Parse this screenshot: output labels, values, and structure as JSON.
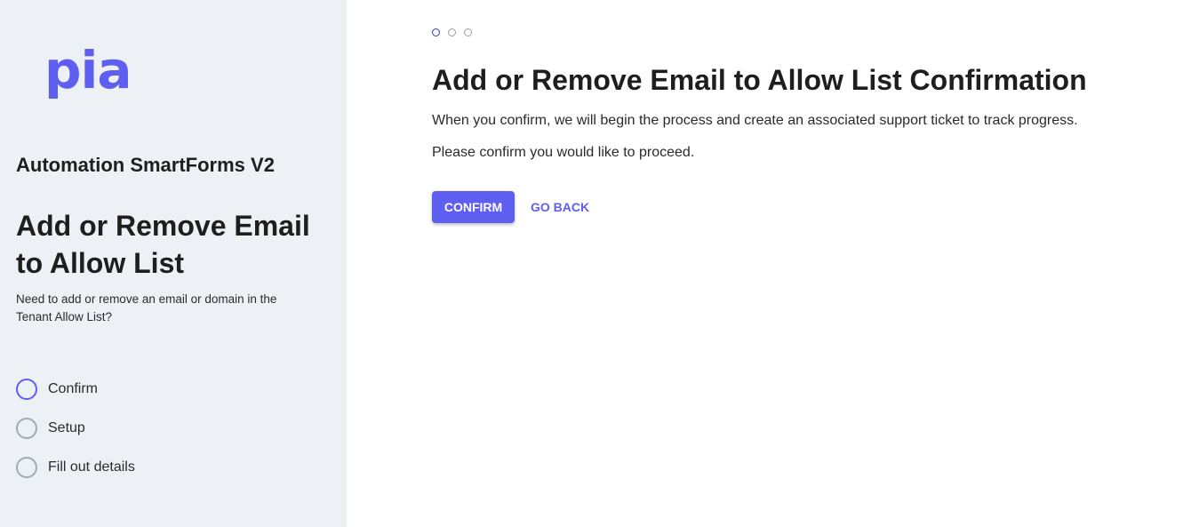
{
  "brand": {
    "logo_text": "pia",
    "accent_color": "#5e5ef1"
  },
  "sidebar": {
    "org_name": "Automation SmartForms V2",
    "title": "Add or Remove Email to Allow List",
    "description": "Need to add or remove an email or domain in the Tenant Allow List?",
    "background_color": "#edf1f6",
    "steps": [
      {
        "label": "Confirm",
        "active": true
      },
      {
        "label": "Setup",
        "active": false
      },
      {
        "label": "Fill out details",
        "active": false
      }
    ]
  },
  "main": {
    "progress": {
      "total_steps": 3,
      "current_step": 1
    },
    "title": "Add or Remove Email to Allow List Confirmation",
    "paragraphs": [
      "When you confirm, we will begin the process and create an associated support ticket to track progress.",
      "Please confirm you would like to proceed."
    ],
    "buttons": {
      "confirm_label": "CONFIRM",
      "back_label": "GO BACK"
    }
  }
}
